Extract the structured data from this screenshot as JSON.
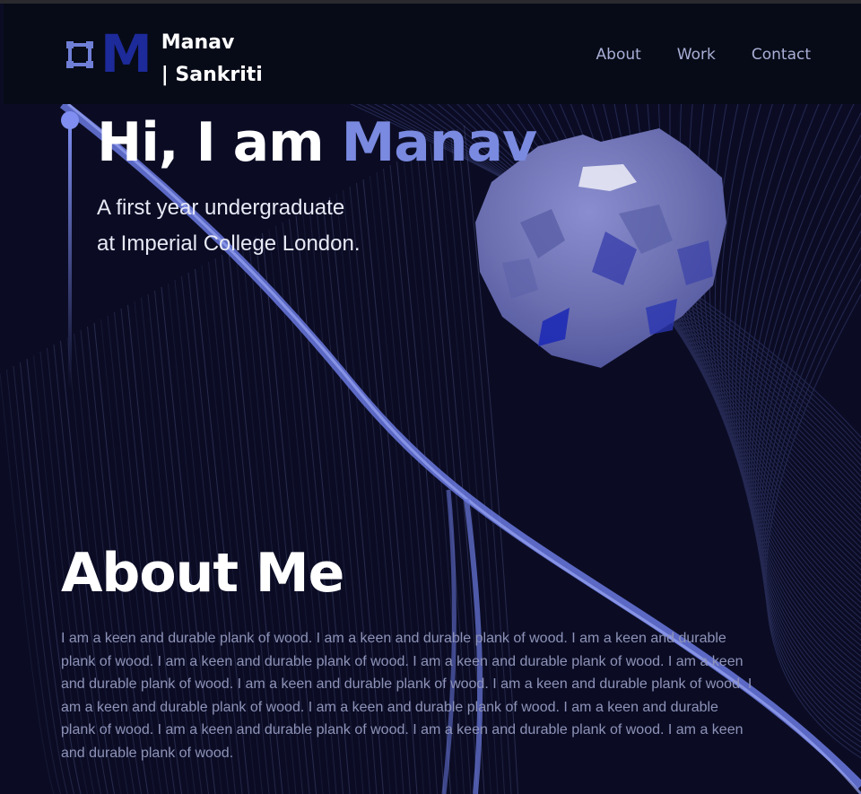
{
  "brand": {
    "logo_letter": "M",
    "name_line1": "Manav",
    "name_line2": "| Sankriti"
  },
  "nav": {
    "items": [
      "About",
      "Work",
      "Contact"
    ]
  },
  "hero": {
    "greeting": "Hi, I am ",
    "name": "Manav",
    "subtitle_line1": "A first year undergraduate",
    "subtitle_line2": "at Imperial College London."
  },
  "about": {
    "title": "About Me",
    "body": "I am a keen and durable plank of wood. I am a keen and durable plank of wood. I am a keen and durable plank of wood. I am a keen and durable plank of wood. I am a keen and durable plank of wood. I am a keen and durable plank of wood. I am a keen and durable plank of wood. I am a keen and durable plank of wood. I am a keen and durable plank of wood. I am a keen and durable plank of wood. I am a keen and durable plank of wood. I am a keen and durable plank of wood. I am a keen and durable plank of wood. I am a keen and durable plank of wood."
  },
  "colors": {
    "background": "#0b0c24",
    "header": "#070b17",
    "accent": "#7a8ae0",
    "logo": "#1d2a9a",
    "text_muted": "#8e93b8"
  },
  "icons": {
    "logo_square": "square-frame-icon",
    "object_3d": "faceted-sphere-icon"
  }
}
